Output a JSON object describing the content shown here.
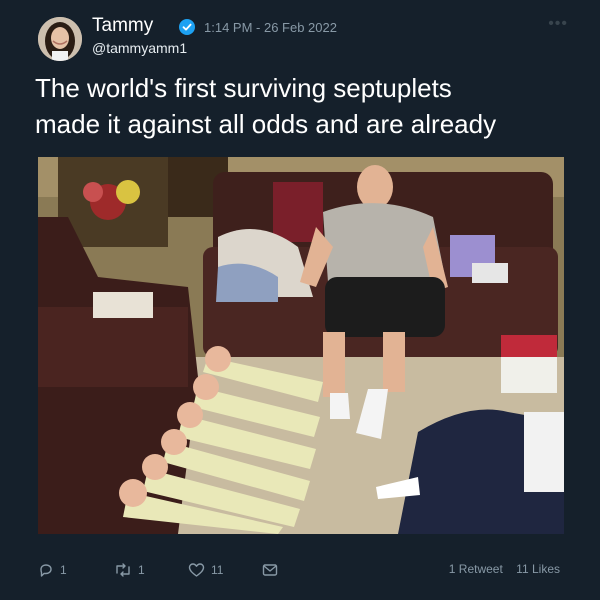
{
  "author": {
    "name": "Tammy",
    "handle": "@tammyamm1",
    "verified": true,
    "avatar_icon": "profile-photo-icon"
  },
  "timestamp": "1:14 PM - 26 Feb 2022",
  "more_icon": "more-dots-icon",
  "tweet": {
    "line1": "The world's first surviving septuplets",
    "line2": "made it against all odds and are already"
  },
  "media": {
    "kind": "photo",
    "description_icon": "tweet-photo-icon"
  },
  "actions": {
    "reply_count": "1",
    "retweet_count": "1",
    "like_count": "11"
  },
  "stats": {
    "retweets_num": "1",
    "retweets_label": "Retweet",
    "likes_num": "11",
    "likes_label": "Likes"
  },
  "colors": {
    "background": "#15202b",
    "muted": "#8899a6",
    "verified": "#1da1f2"
  }
}
